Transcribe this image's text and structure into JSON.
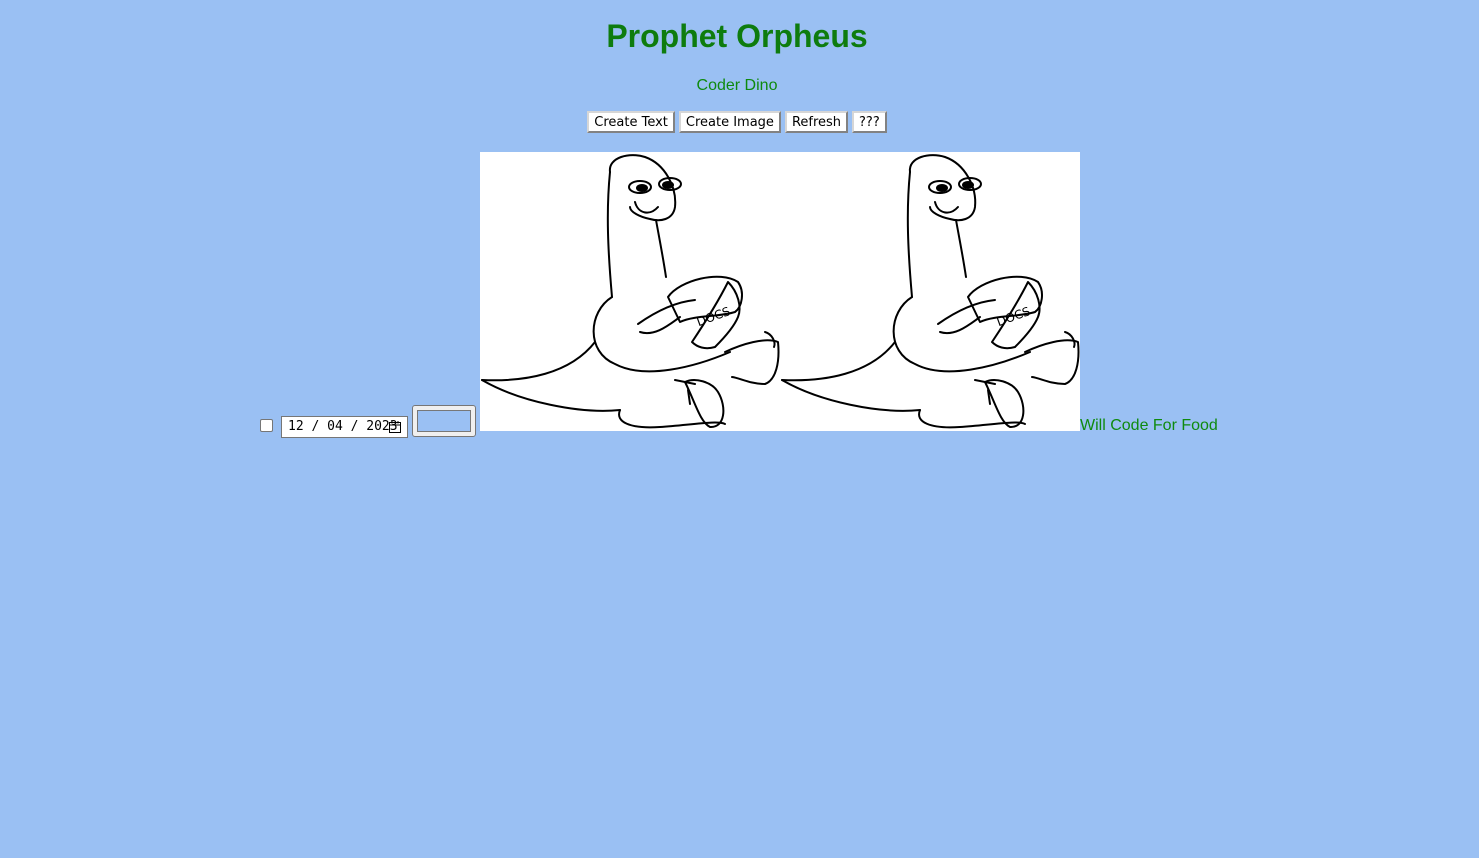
{
  "header": {
    "title": "Prophet Orpheus",
    "subtitle": "Coder Dino"
  },
  "toolbar": {
    "create_text_label": "Create Text",
    "create_image_label": "Create Image",
    "refresh_label": "Refresh",
    "mystery_label": "???"
  },
  "controls": {
    "date_value": "12 / 04 / 2023",
    "checkbox_checked": false,
    "color_value": "#9ac0f3"
  },
  "images": [
    {
      "label": "DOCS"
    },
    {
      "label": "DOCS"
    }
  ],
  "caption": "Will Code For Food",
  "colors": {
    "background": "#9ac0f3",
    "accent_green": "#0e7c0e",
    "image_background": "#ffffff"
  }
}
